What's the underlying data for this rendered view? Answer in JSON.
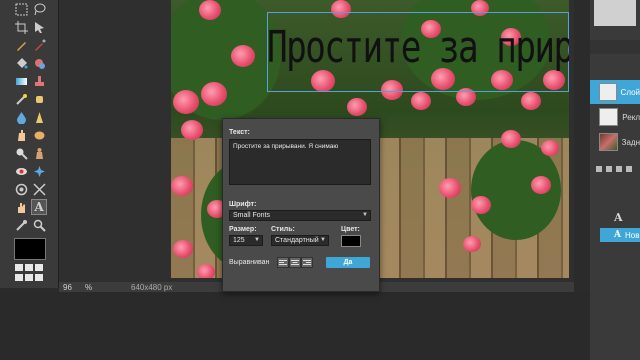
{
  "statusbar": {
    "zoom": "96",
    "zoom_unit": "%",
    "dimensions": "640x480 px"
  },
  "canvas": {
    "text_layer_content": "Простите за прирь"
  },
  "layers": [
    {
      "label": "Слой"
    },
    {
      "label": "Рекл"
    },
    {
      "label": "Задн"
    }
  ],
  "history": {
    "items": [
      {
        "icon": "A",
        "label": ""
      },
      {
        "icon": "A",
        "label": "Нов"
      }
    ]
  },
  "dialog": {
    "text_label": "Текст:",
    "text_value": "Простите за прирывани. Я снимаю",
    "font_label": "Шрифт:",
    "font_value": "Small Fonts",
    "size_label": "Размер:",
    "size_value": "125",
    "style_label": "Стиль:",
    "style_value": "Стандартный",
    "color_label": "Цвет:",
    "color_value": "#000000",
    "align_label": "Выравниван",
    "ok_label": "Да"
  },
  "colors": {
    "accent": "#3ea7d8",
    "panel": "#3a3a3a",
    "background": "#2b2b2b"
  }
}
